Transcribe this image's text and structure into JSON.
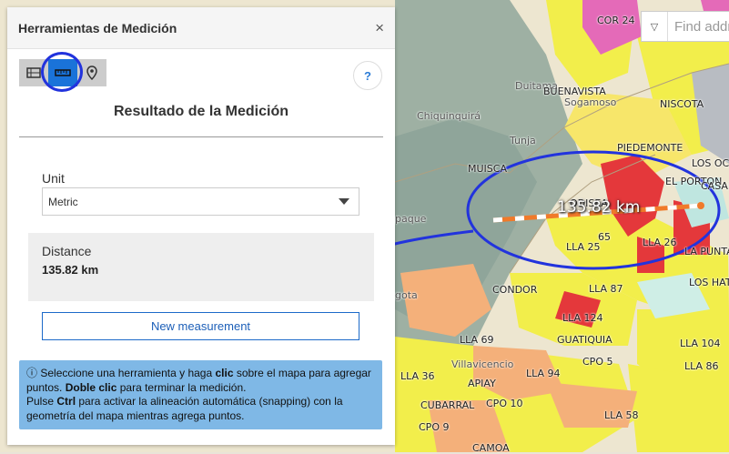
{
  "map": {
    "measurement_label": "135.82 km",
    "labels": [
      {
        "text": "COR 24",
        "kind": "block"
      },
      {
        "text": "Duitama",
        "kind": "town"
      },
      {
        "text": "BUENAVISTA",
        "kind": "block"
      },
      {
        "text": "Sogamoso",
        "kind": "town"
      },
      {
        "text": "NISCOTA",
        "kind": "block"
      },
      {
        "text": "Chiquinquirá",
        "kind": "town"
      },
      {
        "text": "Tunja",
        "kind": "town"
      },
      {
        "text": "PIEDEMONTE",
        "kind": "block"
      },
      {
        "text": "MUISCA",
        "kind": "block"
      },
      {
        "text": "EL PORTON",
        "kind": "block"
      },
      {
        "text": "LOS OCA",
        "kind": "block"
      },
      {
        "text": "CASAN",
        "kind": "block"
      },
      {
        "text": "ODISEA",
        "kind": "block"
      },
      {
        "text": "LLA 25",
        "kind": "block"
      },
      {
        "text": "LLA 26",
        "kind": "block"
      },
      {
        "text": "LA PUNTA",
        "kind": "block"
      },
      {
        "text": "LOS HATOS",
        "kind": "block"
      },
      {
        "text": "paque",
        "kind": "town"
      },
      {
        "text": "gota",
        "kind": "town"
      },
      {
        "text": "CONDOR",
        "kind": "block"
      },
      {
        "text": "LLA 87",
        "kind": "block"
      },
      {
        "text": "LLA 124",
        "kind": "block"
      },
      {
        "text": "LLA 69",
        "kind": "block"
      },
      {
        "text": "GUATIQUIA",
        "kind": "block"
      },
      {
        "text": "LLA 104",
        "kind": "block"
      },
      {
        "text": "Villavicencio",
        "kind": "town"
      },
      {
        "text": "CPO 5",
        "kind": "block"
      },
      {
        "text": "LLA 86",
        "kind": "block"
      },
      {
        "text": "LLA 36",
        "kind": "block"
      },
      {
        "text": "APIAY",
        "kind": "block"
      },
      {
        "text": "LLA 94",
        "kind": "block"
      },
      {
        "text": "CUBARRAL",
        "kind": "block"
      },
      {
        "text": "CPO 10",
        "kind": "block"
      },
      {
        "text": "LLA 58",
        "kind": "block"
      },
      {
        "text": "CPO 9",
        "kind": "block"
      },
      {
        "text": "CAMOA",
        "kind": "block"
      },
      {
        "text": "65",
        "kind": "block"
      }
    ]
  },
  "search": {
    "placeholder": "Find addr"
  },
  "panel": {
    "title": "Herramientas de Medición",
    "close_label": "×",
    "help_label": "?",
    "tools": [
      {
        "name": "area-tool",
        "active": false
      },
      {
        "name": "distance-tool",
        "active": true
      },
      {
        "name": "location-tool",
        "active": false
      }
    ],
    "result_title": "Resultado de la Medición",
    "unit_label": "Unit",
    "unit_value": "Metric",
    "distance_label": "Distance",
    "distance_value": "135.82 km",
    "new_button": "New measurement",
    "hint": {
      "line1_a": "Seleccione una herramienta y haga ",
      "line1_b": "clic",
      "line1_c": " sobre el mapa para agregar puntos. ",
      "line1_d": "Doble clic",
      "line1_e": " para terminar la medición.",
      "line2_a": "Pulse ",
      "line2_b": "Ctrl",
      "line2_c": " para activar la alineación automática (snapping) con la geometría del mapa mientras agrega puntos."
    }
  },
  "colors": {
    "accent": "#1a73d9",
    "hint_bg": "#7fb8e6",
    "annotation": "#2233dd",
    "measure_line": "#f07a2a"
  }
}
